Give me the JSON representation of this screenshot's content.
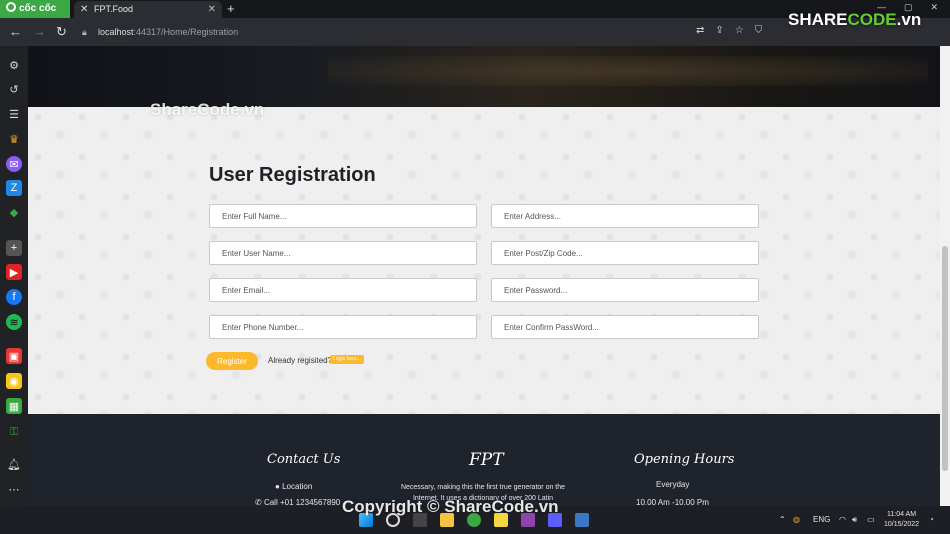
{
  "browser": {
    "brand": "cốc cốc",
    "tab_title": "FPT.Food",
    "url_host": "localhost",
    "url_rest": ":44317/Home/Registration"
  },
  "page": {
    "title": "User Registration",
    "fields": {
      "full_name": "Enter Full Name...",
      "address": "Enter Address...",
      "user_name": "Enter User Name...",
      "postcode": "Enter Post/Zip Code...",
      "email": "Enter Email...",
      "password": "Enter Password...",
      "phone": "Enter Phone Number...",
      "confirm_password": "Enter Confirm PassWord..."
    },
    "register_label": "Register",
    "already_text": "Already regisited?",
    "login_label": "Login here..."
  },
  "footer": {
    "contact_title": "Contact Us",
    "location": "Location",
    "phone": "Call +01 1234567890",
    "brand_title": "FPT",
    "about": "Necessary, making this the first true generator on the Internet. It uses a dictionary of over 200 Latin",
    "hours_title": "Opening Hours",
    "hours_days": "Everyday",
    "hours_time": "10.00 Am -10.00 Pm"
  },
  "watermarks": {
    "top": "ShareCode.vn",
    "logo_prefix": "SHARE",
    "logo_mid": "CODE",
    "logo_suffix": ".vn",
    "bottom": "Copyright © ShareCode.vn"
  },
  "taskbar": {
    "lang": "ENG",
    "time": "11:04 AM",
    "date": "10/15/2022"
  }
}
